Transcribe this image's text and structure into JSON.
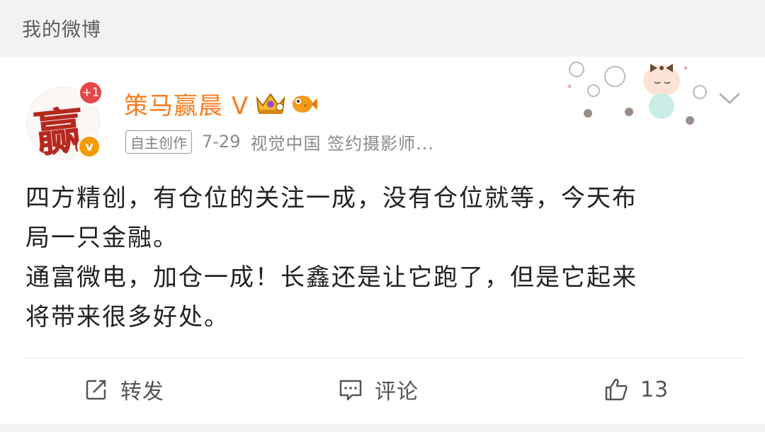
{
  "header": {
    "title": "我的微博"
  },
  "post": {
    "avatar_char": "赢",
    "new_badge": "+1",
    "verified_badge": "v",
    "username": "策马赢晨",
    "user_v": "V",
    "crown_icon": "crown-icon",
    "fish_icon": "pufferfish-icon",
    "tag": "自主创作",
    "date": "7-29",
    "source": "视觉中国 签约摄影师...",
    "lines": [
      "四方精创，有仓位的关注一成，没有仓位就等，今天布",
      "局一只金融。",
      "通富微电，加仓一成！长鑫还是让它跑了，但是它起来",
      "将带来很多好处。"
    ]
  },
  "actions": {
    "repost": {
      "label": "转发",
      "icon": "repost-icon"
    },
    "comment": {
      "label": "评论",
      "icon": "comment-icon"
    },
    "like": {
      "count": "13",
      "icon": "thumbs-up-icon"
    }
  },
  "colors": {
    "username": "#f77b1e",
    "badge_red": "#e6464a",
    "badge_orange": "#f39b00"
  }
}
